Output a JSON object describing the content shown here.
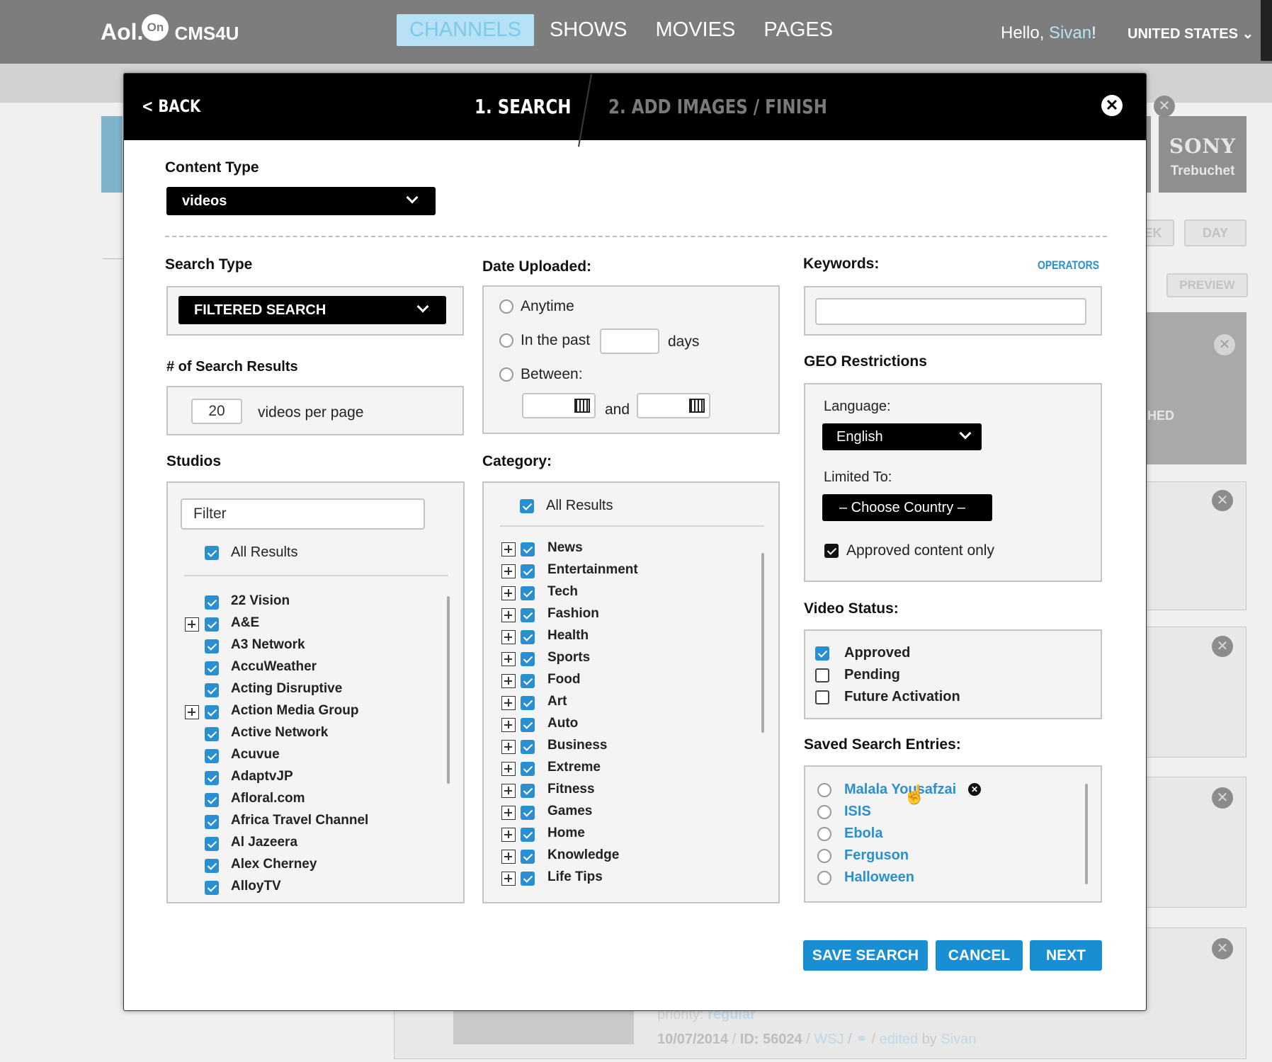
{
  "topbar": {
    "logo": "Aol.",
    "logo_badge": "On",
    "product": "CMS4U",
    "nav": [
      "CHANNELS",
      "SHOWS",
      "MOVIES",
      "PAGES"
    ],
    "greeting": "Hello, ",
    "user": "Sivan",
    "greeting_end": "!",
    "region": "UNITED STATES"
  },
  "background": {
    "sony_brand": "SONY",
    "sony_sub": "Trebuchet",
    "btn_week": "EK",
    "btn_day": "DAY",
    "btn_preview": "PREVIEW",
    "published": "HED",
    "priority_label": "priority: ",
    "priority_value": "regular",
    "date": "10/07/2014",
    "id": "ID: 56024",
    "source": "WSJ",
    "edited": "edited",
    "by": "by",
    "editor": "Sivan"
  },
  "modal": {
    "back": "< BACK",
    "step1": "1.  SEARCH",
    "step2": "2.  ADD IMAGES / FINISH",
    "content_type_label": "Content Type",
    "content_type_value": "videos",
    "search_type_label": "Search Type",
    "search_type_value": "FILTERED SEARCH",
    "results_label": "# of Search Results",
    "results_value": "20",
    "results_suffix": "videos per page",
    "date_label": "Date Uploaded:",
    "date_anytime": "Anytime",
    "date_past": "In the past",
    "date_days": "days",
    "date_between": "Between:",
    "date_and": "and",
    "keywords_label": "Keywords:",
    "operators": "OPERATORS",
    "geo_label": "GEO Restrictions",
    "language_label": "Language:",
    "language_value": "English",
    "limited_label": "Limited To:",
    "country_value": "– Choose Country –",
    "approved_only": "Approved content only",
    "video_status_label": "Video Status:",
    "status_options": [
      "Approved",
      "Pending",
      "Future Activation"
    ],
    "saved_label": "Saved Search Entries:",
    "saved_entries": [
      "Malala Yousafzai",
      "ISIS",
      "Ebola",
      "Ferguson",
      "Halloween"
    ],
    "studios_label": "Studios",
    "studios_filter_placeholder": "Filter",
    "studios_all": "All Results",
    "studios": [
      "22 Vision",
      "A&E",
      "A3 Network",
      "AccuWeather",
      "Acting Disruptive",
      "Action Media Group",
      "Active Network",
      "Acuvue",
      "AdaptvJP",
      "Afloral.com",
      "Africa Travel Channel",
      "Al Jazeera",
      "Alex Cherney",
      "AlloyTV"
    ],
    "category_label": "Category:",
    "category_all": "All Results",
    "categories": [
      "News",
      "Entertainment",
      "Tech",
      "Fashion",
      "Health",
      "Sports",
      "Food",
      "Art",
      "Auto",
      "Business",
      "Extreme",
      "Fitness",
      "Games",
      "Home",
      "Knowledge",
      "Life Tips"
    ],
    "btn_save": "SAVE SEARCH",
    "btn_cancel": "CANCEL",
    "btn_next": "NEXT"
  }
}
